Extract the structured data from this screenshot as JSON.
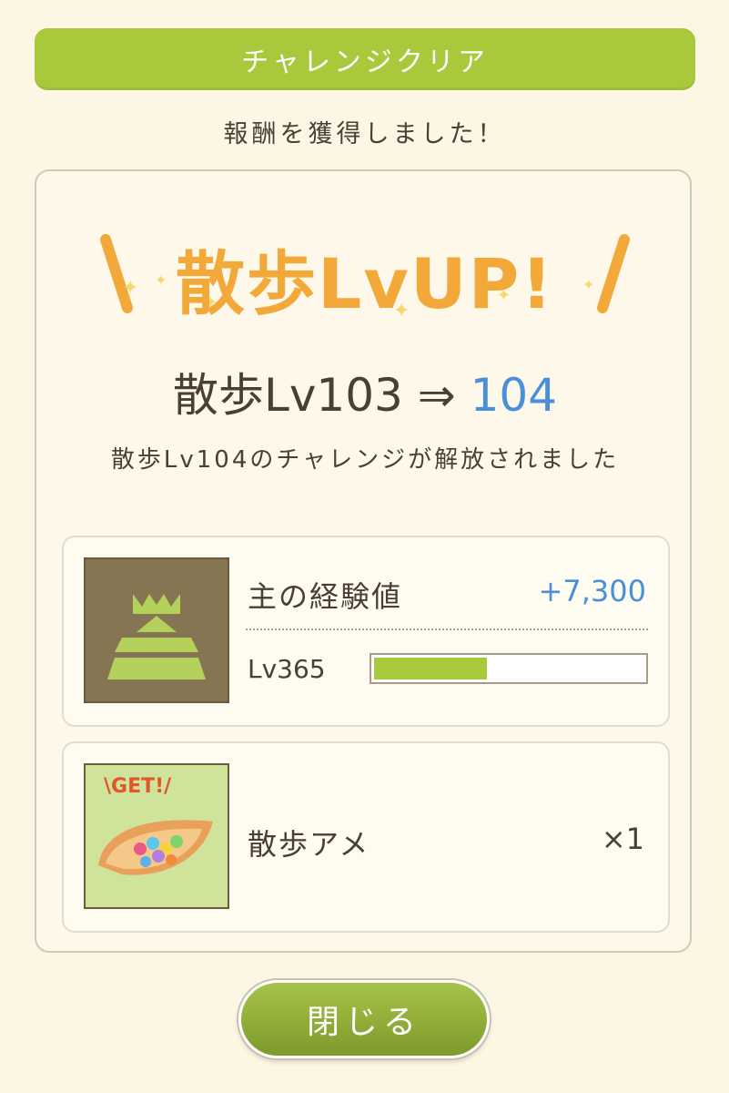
{
  "header": {
    "title": "チャレンジクリア"
  },
  "subtitle": "報酬を獲得しました！",
  "banner": {
    "text": "散歩LvUP!"
  },
  "level": {
    "from_text": "散歩Lv103",
    "arrow": "⇒",
    "to_text": "104"
  },
  "unlock_message": "散歩Lv104のチャレンジが解放されました",
  "rewards": {
    "exp": {
      "label": "主の経験値",
      "value": "+7,300",
      "level_label": "Lv365",
      "progress": 0.42,
      "icon": "castle-icon"
    },
    "item": {
      "label": "散歩アメ",
      "count": "×1",
      "badge": "\\GET!/",
      "icon": "candy-dish-icon"
    }
  },
  "close_button": {
    "label": "閉じる"
  },
  "colors": {
    "accent_green": "#a8c93c",
    "banner_orange": "#f2a93a",
    "value_blue": "#4a8fd8"
  }
}
